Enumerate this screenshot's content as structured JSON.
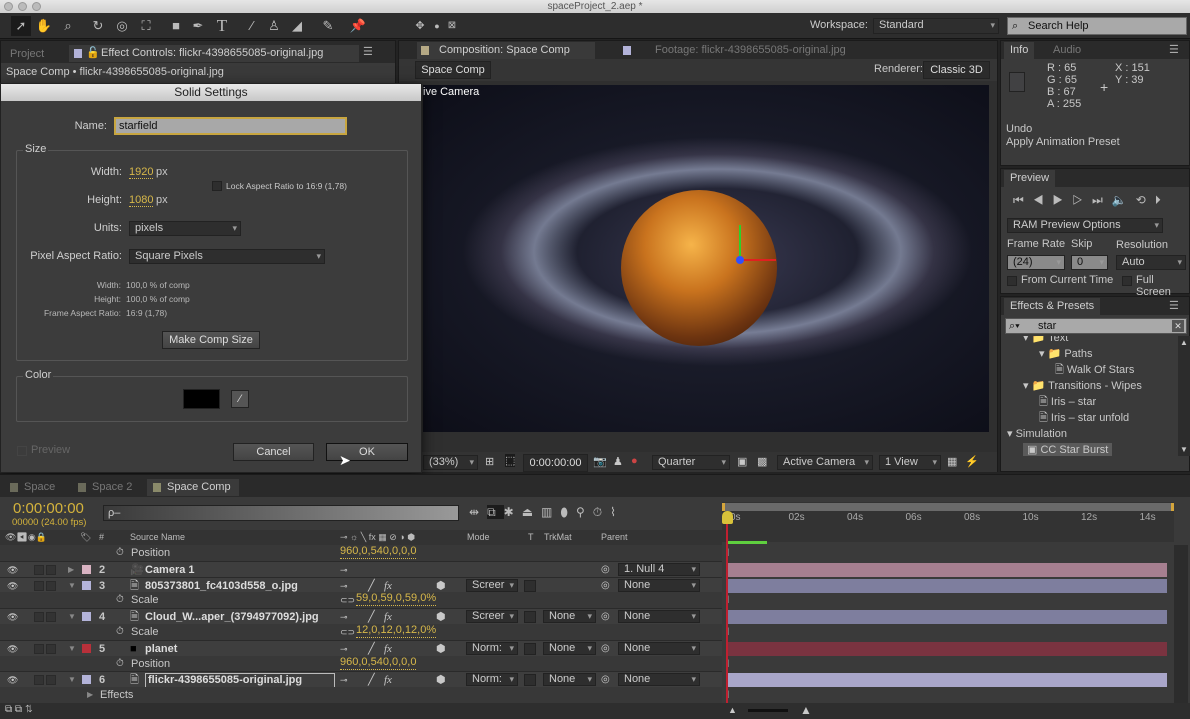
{
  "window": {
    "title": "spaceProject_2.aep *"
  },
  "toolbar": {
    "tools": [
      "selection-tool",
      "hand-tool",
      "zoom-tool",
      "rotate-tool",
      "camera-orbit-tool",
      "camera-track-tool",
      "rectangle-tool",
      "pen-tool",
      "type-tool",
      "brush-tool",
      "clone-stamp-tool",
      "eraser-tool",
      "roto-brush-tool",
      "puppet-pin-tool"
    ],
    "workspace_label": "Workspace:",
    "workspace_value": "Standard",
    "search_placeholder": "Search Help"
  },
  "left_panel": {
    "tabs": [
      "Project",
      "Effect Controls: flickr-4398655085-original.jpg"
    ],
    "breadcrumb": "Space Comp • flickr-4398655085-original.jpg"
  },
  "dialog": {
    "title": "Solid Settings",
    "name_label": "Name:",
    "name_value": "starfield",
    "size_group": "Size",
    "width_label": "Width:",
    "width_value": "1920",
    "height_label": "Height:",
    "height_value": "1080",
    "px": "px",
    "lock_label": "Lock Aspect Ratio to 16:9 (1,78)",
    "lock_checked": false,
    "units_label": "Units:",
    "units_value": "pixels",
    "par_label": "Pixel Aspect Ratio:",
    "par_value": "Square Pixels",
    "info_width_label": "Width:",
    "info_width": "100,0 % of comp",
    "info_height_label": "Height:",
    "info_height": "100,0 % of comp",
    "info_far_label": "Frame Aspect Ratio:",
    "info_far": "16:9 (1,78)",
    "make_comp_size": "Make Comp Size",
    "color_group": "Color",
    "color_value": "#000000",
    "preview_label": "Preview",
    "cancel": "Cancel",
    "ok": "OK"
  },
  "comp_panel": {
    "tabs": [
      "Composition: Space Comp",
      "Footage: flickr-4398655085-original.jpg"
    ],
    "comp_button": "Space Comp",
    "renderer_label": "Renderer:",
    "renderer_value": "Classic 3D",
    "view_label": "ive Camera",
    "zoom": "(33%)",
    "timecode": "0:00:00:00",
    "resolution": "Quarter",
    "camera": "Active Camera",
    "views": "1 View"
  },
  "info": {
    "tabs": [
      "Info",
      "Audio"
    ],
    "r": "R : 65",
    "g": "G : 65",
    "b": "B : 67",
    "a": "A : 255",
    "x": "X : 151",
    "y": "Y : 39",
    "undo": "Undo",
    "undo_action": "Apply Animation Preset"
  },
  "preview": {
    "tab": "Preview",
    "ram_options": "RAM Preview Options",
    "frame_rate_label": "Frame Rate",
    "skip_label": "Skip",
    "resolution_label": "Resolution",
    "frame_rate": "(24)",
    "skip": "0",
    "resolution": "Auto",
    "from_current": "From Current Time",
    "full_screen": "Full Screen"
  },
  "effects": {
    "tab": "Effects & Presets",
    "search": "star",
    "items": [
      {
        "label": "Text",
        "depth": 1,
        "type": "folder"
      },
      {
        "label": "Paths",
        "depth": 2,
        "type": "folder"
      },
      {
        "label": "Walk Of Stars",
        "depth": 3,
        "type": "preset"
      },
      {
        "label": "Transitions - Wipes",
        "depth": 1,
        "type": "folder"
      },
      {
        "label": "Iris – star",
        "depth": 2,
        "type": "preset"
      },
      {
        "label": "Iris – star unfold",
        "depth": 2,
        "type": "preset"
      },
      {
        "label": "Simulation",
        "depth": 0,
        "type": "category"
      },
      {
        "label": "CC Star Burst",
        "depth": 1,
        "type": "effect",
        "selected": true
      }
    ]
  },
  "timeline": {
    "tabs": [
      "Space",
      "Space 2",
      "Space Comp"
    ],
    "timecode": "0:00:00:00",
    "frames": "00000 (24.00 fps)",
    "search_placeholder": "ρ–",
    "headers": {
      "num": "#",
      "source": "Source Name",
      "mode": "Mode",
      "t": "T",
      "trkmat": "TrkMat",
      "parent": "Parent"
    },
    "ruler": [
      "0s",
      "02s",
      "04s",
      "06s",
      "08s",
      "10s",
      "12s",
      "14s"
    ],
    "rows": [
      {
        "kind": "prop",
        "name": "Position",
        "value": "960,0,540,0,0,0"
      },
      {
        "kind": "layer",
        "num": "2",
        "name": "Camera 1",
        "color": "#d9b3c2",
        "icon": "camera",
        "parent": "1. Null 4",
        "bar": "#a67f90"
      },
      {
        "kind": "layer",
        "num": "3",
        "name": "805373801_fc4103d558_o.jpg",
        "color": "#b3b3d9",
        "icon": "footage",
        "mode": "Screer",
        "parent": "None",
        "bar": "#7e7e9e"
      },
      {
        "kind": "prop",
        "name": "Scale",
        "value": "59,0,59,0,59,0%"
      },
      {
        "kind": "layer",
        "num": "4",
        "name": "Cloud_W...aper_(3794977092).jpg",
        "color": "#b3b3d9",
        "icon": "footage",
        "mode": "Screer",
        "trkmat": "None",
        "parent": "None",
        "bar": "#7e7e9e"
      },
      {
        "kind": "prop",
        "name": "Scale",
        "value": "12,0,12,0,12,0%"
      },
      {
        "kind": "layer",
        "num": "5",
        "name": "planet",
        "color": "#b8303a",
        "icon": "solid",
        "mode": "Norm:",
        "trkmat": "None",
        "parent": "None",
        "bar": "#7a3340"
      },
      {
        "kind": "prop",
        "name": "Position",
        "value": "960,0,540,0,0,0"
      },
      {
        "kind": "layer",
        "num": "6",
        "name": "flickr-4398655085-original.jpg",
        "color": "#b3b3d9",
        "icon": "footage",
        "mode": "Norm:",
        "trkmat": "None",
        "parent": "None",
        "bar": "#a9a6c9"
      },
      {
        "kind": "group",
        "name": "Effects"
      }
    ]
  }
}
